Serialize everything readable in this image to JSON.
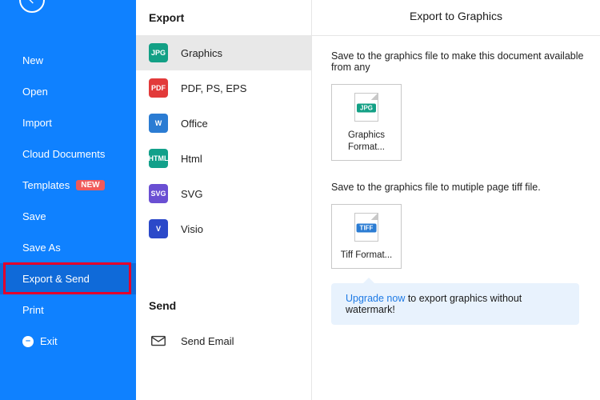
{
  "sidebar": {
    "items": [
      {
        "label": "New"
      },
      {
        "label": "Open"
      },
      {
        "label": "Import"
      },
      {
        "label": "Cloud Documents"
      },
      {
        "label": "Templates",
        "badge": "NEW"
      },
      {
        "label": "Save"
      },
      {
        "label": "Save As"
      },
      {
        "label": "Export & Send"
      },
      {
        "label": "Print"
      },
      {
        "label": "Exit"
      }
    ]
  },
  "mid": {
    "export_heading": "Export",
    "send_heading": "Send",
    "export_items": [
      {
        "icon_text": "JPG",
        "label": "Graphics"
      },
      {
        "icon_text": "PDF",
        "label": "PDF, PS, EPS"
      },
      {
        "icon_text": "W",
        "label": "Office"
      },
      {
        "icon_text": "HTML",
        "label": "Html"
      },
      {
        "icon_text": "SVG",
        "label": "SVG"
      },
      {
        "icon_text": "V",
        "label": "Visio"
      }
    ],
    "send_items": [
      {
        "label": "Send Email"
      }
    ]
  },
  "main": {
    "title": "Export to Graphics",
    "block1": {
      "desc": "Save to the graphics file to make this document available from any",
      "tile_tag": "JPG",
      "tile_label": "Graphics Format..."
    },
    "block2": {
      "desc": "Save to the graphics file to mutiple page tiff file.",
      "tile_tag": "TIFF",
      "tile_label": "Tiff Format..."
    },
    "promo_link": "Upgrade now",
    "promo_rest": " to export graphics without watermark!"
  }
}
